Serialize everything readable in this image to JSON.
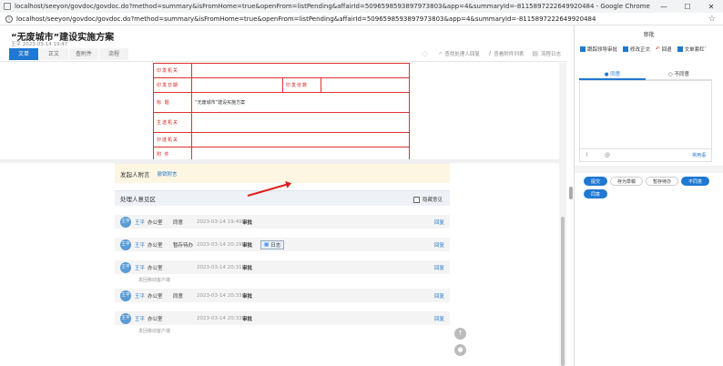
{
  "window": {
    "title": "localhost/seeyon/govdoc/govdoc.do?method=summary&isFromHome=true&openFrom=listPending&affairId=5096598593897973803&app=4&summaryId=-811589722264992048​4 - Google Chrome",
    "url": "localhost/seeyon/govdoc/govdoc.do?method=summary&isFromHome=true&openFrom=listPending&affairId=5096598593897973803&app=4&summaryId=-8115897222649920484",
    "minimize": "—",
    "maximize": "☐",
    "close": "✕"
  },
  "header": {
    "title": "“无废城市”建设实施方案",
    "meta": "王平 2023-03-14 19:47",
    "tabs": [
      {
        "label": "文单"
      },
      {
        "label": "正文"
      },
      {
        "label": "查附件"
      },
      {
        "label": "流程"
      }
    ],
    "toolbar": {
      "find_label": "查找处理人回复",
      "attach_label": "查看附件列表",
      "log_label": "流程日志"
    }
  },
  "form": {
    "rows": [
      {
        "label": "印发机关",
        "value": ""
      },
      {
        "label": "印发日期",
        "value": "",
        "label2": "印发份数",
        "value2": ""
      },
      {
        "label": "标    题",
        "value": "“无废城市”建设实施方案"
      },
      {
        "label": "主送机关",
        "value": ""
      },
      {
        "label": "抄送机关",
        "value": ""
      },
      {
        "label": "附    件",
        "value": ""
      }
    ]
  },
  "initiator": {
    "title": "发起人附言",
    "link": "撤销附言"
  },
  "opinions": {
    "title": "处理人意见区",
    "hide_label": "隐藏意见",
    "rows": [
      {
        "avatar": "王平",
        "name": "王平",
        "dept": "办公室",
        "action": "同意",
        "time": "2023-03-14 19:49",
        "aud": "审批",
        "reply": "回复",
        "note": "",
        "log": ""
      },
      {
        "avatar": "王平",
        "name": "王平",
        "dept": "办公室",
        "action": "暂存待办",
        "time": "2023-03-14 20:29",
        "aud": "审批",
        "reply": "回复",
        "note": "",
        "log": "日志"
      },
      {
        "avatar": "王平",
        "name": "王平",
        "dept": "办公室",
        "action": "",
        "time": "2023-03-14 20:31",
        "aud": "审批",
        "reply": "回复",
        "note": "发回移动客户端",
        "log": ""
      },
      {
        "avatar": "王平",
        "name": "王平",
        "dept": "办公室",
        "action": "同意",
        "time": "2023-03-14 20:33",
        "aud": "审批",
        "reply": "回复",
        "note": "",
        "log": ""
      },
      {
        "avatar": "王平",
        "name": "王平",
        "dept": "办公室",
        "action": "",
        "time": "2023-03-14 20:33",
        "aud": "审批",
        "reply": "回复",
        "note": "发回移动客户端",
        "log": ""
      }
    ]
  },
  "side": {
    "title": "审批",
    "options": [
      "跟踪领导审批",
      "修改正文",
      "回退",
      "文单套红"
    ],
    "more": "···",
    "radio_agree": "同意",
    "radio_disagree": "不同意",
    "common_phrases": "常用语",
    "buttons": [
      "提交",
      "存为草稿",
      "暂存待办",
      "不同意",
      "同意"
    ]
  }
}
